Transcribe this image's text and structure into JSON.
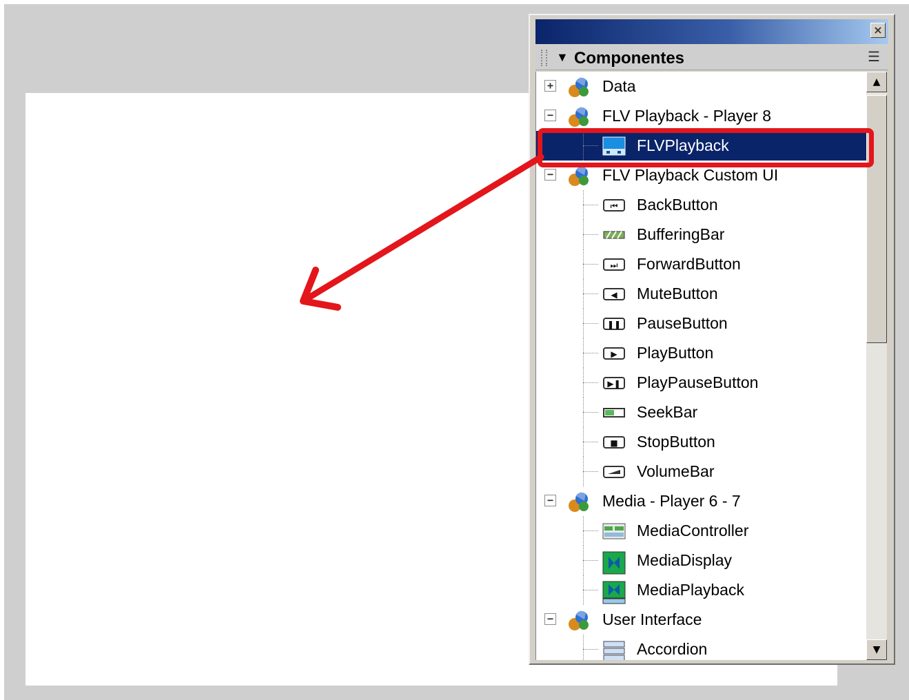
{
  "panel": {
    "title": "Componentes",
    "close_glyph": "×",
    "options_glyph": "☰",
    "collapse_glyph": "▼"
  },
  "tree": [
    {
      "kind": "category",
      "label": "Data",
      "expander": "+",
      "icon": "component-folder-icon"
    },
    {
      "kind": "category",
      "label": "FLV Playback - Player 8",
      "expander": "−",
      "icon": "component-folder-icon"
    },
    {
      "kind": "item",
      "label": "FLVPlayback",
      "icon": "flvplayback-icon",
      "selected": true
    },
    {
      "kind": "category",
      "label": "FLV Playback Custom UI",
      "expander": "−",
      "icon": "component-folder-icon"
    },
    {
      "kind": "item",
      "label": "BackButton",
      "icon": "back-button-icon"
    },
    {
      "kind": "item",
      "label": "BufferingBar",
      "icon": "buffering-bar-icon"
    },
    {
      "kind": "item",
      "label": "ForwardButton",
      "icon": "forward-button-icon"
    },
    {
      "kind": "item",
      "label": "MuteButton",
      "icon": "mute-button-icon"
    },
    {
      "kind": "item",
      "label": "PauseButton",
      "icon": "pause-button-icon"
    },
    {
      "kind": "item",
      "label": "PlayButton",
      "icon": "play-button-icon"
    },
    {
      "kind": "item",
      "label": "PlayPauseButton",
      "icon": "play-pause-button-icon"
    },
    {
      "kind": "item",
      "label": "SeekBar",
      "icon": "seek-bar-icon"
    },
    {
      "kind": "item",
      "label": "StopButton",
      "icon": "stop-button-icon"
    },
    {
      "kind": "item",
      "label": "VolumeBar",
      "icon": "volume-bar-icon"
    },
    {
      "kind": "category",
      "label": "Media - Player 6 - 7",
      "expander": "−",
      "icon": "component-folder-icon"
    },
    {
      "kind": "item",
      "label": "MediaController",
      "icon": "media-controller-icon"
    },
    {
      "kind": "item",
      "label": "MediaDisplay",
      "icon": "media-display-icon"
    },
    {
      "kind": "item",
      "label": "MediaPlayback",
      "icon": "media-playback-icon"
    },
    {
      "kind": "category",
      "label": "User Interface",
      "expander": "−",
      "icon": "component-folder-icon"
    },
    {
      "kind": "item",
      "label": "Accordion",
      "icon": "accordion-icon"
    }
  ],
  "scrollbar": {
    "up_glyph": "▲",
    "down_glyph": "▼"
  },
  "colors": {
    "selection": "#0a246a",
    "annotation": "#e3161b",
    "panel_face": "#d4d0c8"
  }
}
